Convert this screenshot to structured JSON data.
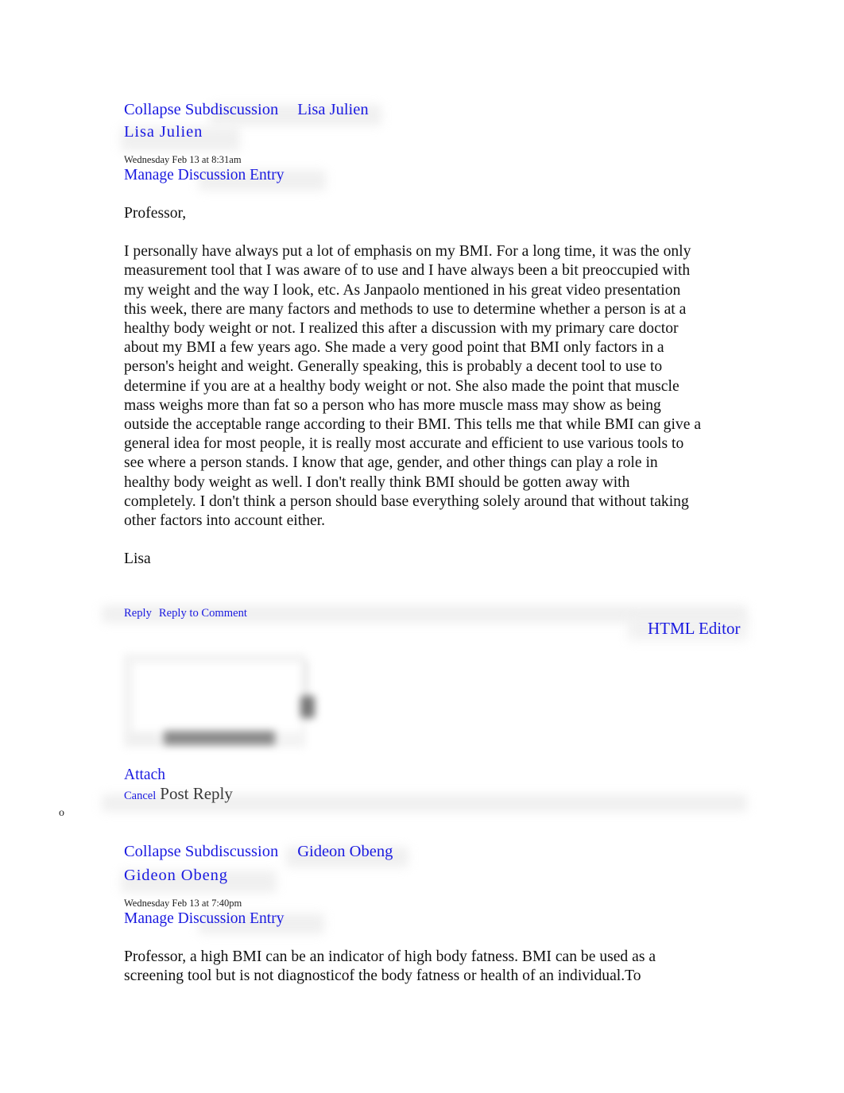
{
  "page": {
    "background_color": "#ffffff",
    "link_color": "#1a1ae0",
    "text_color": "#111111",
    "muted_text_color": "#3a3a3a"
  },
  "entries": [
    {
      "collapse_label": "Collapse Subdiscussion",
      "header_author": "Lisa Julien",
      "author_name": "Lisa Julien",
      "timestamp": "Wednesday Feb 13 at 8:31am",
      "manage_label": "Manage Discussion Entry",
      "salutation": "Professor,",
      "body": "I personally have always put a lot of emphasis on my BMI. For a long time, it was the only measurement tool that I was aware of to use and I have always been a bit preoccupied with my weight and the way I look, etc. As Janpaolo mentioned in his great video presentation this week, there are many factors and methods to use to determine whether a person is at a healthy body weight or not. I realized this after a discussion with my primary care doctor about my BMI a few years ago. She made a very good point that BMI only factors in a person's height and weight. Generally speaking, this is probably a decent tool to use to determine if you are at a healthy body weight or not. She also made the point that muscle mass weighs more than fat so a person who has more muscle mass may show as being outside the acceptable range according to their BMI. This tells me that while BMI can give a general idea for most people, it is really most accurate and efficient to use various tools to see where a person stands. I know that age, gender, and other things can play a role in healthy body weight as well. I don't really think BMI should be gotten away with completely. I don't think a person should base everything solely around that without taking other factors into account either.",
      "signature": "Lisa"
    },
    {
      "collapse_label": "Collapse Subdiscussion",
      "header_author": "Gideon Obeng",
      "author_name": "Gideon Obeng",
      "timestamp": "Wednesday Feb 13 at 7:40pm",
      "manage_label": "Manage Discussion Entry",
      "body": "Professor, a high BMI can be an indicator of high body fatness. BMI can be used as a screening tool but is not diagnosticof the body fatness or health of an individual.To"
    }
  ],
  "reply_toolbar": {
    "reply_label": "Reply",
    "reply_to_comment_label": "Reply to Comment"
  },
  "reply_form": {
    "html_editor_label": "HTML Editor",
    "editor_content": "",
    "attach_label": "Attach",
    "cancel_label": "Cancel",
    "post_reply_label": "Post Reply"
  },
  "outline_marker": "o"
}
